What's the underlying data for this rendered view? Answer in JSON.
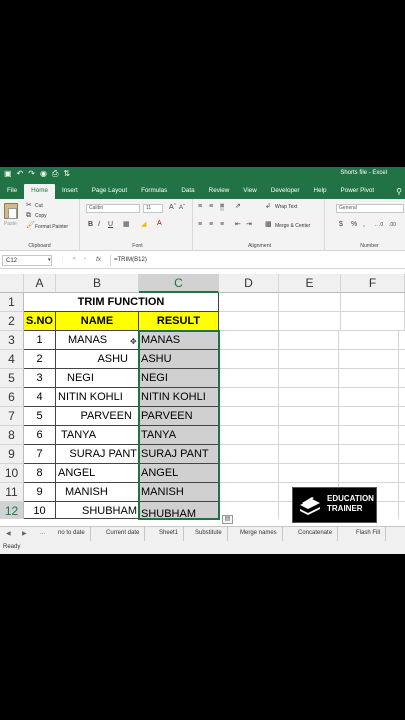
{
  "app": {
    "window_title": "Shorts file  -  Excel",
    "accent": "#217346"
  },
  "ribbon_tabs": [
    "File",
    "Home",
    "Insert",
    "Page Layout",
    "Formulas",
    "Data",
    "Review",
    "View",
    "Developer",
    "Help",
    "Power Pivot"
  ],
  "ribbon": {
    "clipboard": {
      "cut": "Cut",
      "copy": "Copy",
      "format_painter": "Format Painter",
      "paste": "Paste",
      "label": "Clipboard"
    },
    "font": {
      "name": "Calibri",
      "size": "11",
      "label": "Font"
    },
    "alignment": {
      "wrap_text": "Wrap Text",
      "merge_center": "Merge & Center",
      "label": "Alignment"
    },
    "number": {
      "format": "General",
      "label": "Number"
    }
  },
  "formula_bar": {
    "name_box": "C12",
    "fx": "fx",
    "formula": "=TRIM(B12)"
  },
  "columns": [
    "A",
    "B",
    "C",
    "D",
    "E",
    "F"
  ],
  "rows": [
    "1",
    "2",
    "3",
    "4",
    "5",
    "6",
    "7",
    "8",
    "9",
    "10",
    "11",
    "12"
  ],
  "sheet": {
    "title": "TRIM FUNCTION",
    "headers": {
      "sno": "S.NO",
      "name": "NAME",
      "result": "RESULT"
    },
    "data": [
      {
        "sno": "1",
        "name": "MANAS",
        "result": "MANAS"
      },
      {
        "sno": "2",
        "name": "ASHU",
        "result": "ASHU"
      },
      {
        "sno": "3",
        "name": "NEGI",
        "result": "NEGI"
      },
      {
        "sno": "4",
        "name": "NITIN KOHLI",
        "result": "NITIN KOHLI"
      },
      {
        "sno": "5",
        "name": "PARVEEN",
        "result": "PARVEEN"
      },
      {
        "sno": "6",
        "name": "TANYA",
        "result": "TANYA"
      },
      {
        "sno": "7",
        "name": "SURAJ PANT",
        "result": "SURAJ PANT"
      },
      {
        "sno": "8",
        "name": "ANGEL",
        "result": "ANGEL"
      },
      {
        "sno": "9",
        "name": "MANISH",
        "result": "MANISH"
      },
      {
        "sno": "10",
        "name": "SHUBHAM",
        "result": "SHUBHAM"
      }
    ]
  },
  "sheet_tabs": {
    "ellipsis": "...",
    "items": [
      "no to date",
      "Current date",
      "Sheet1",
      "Substitute",
      "Merge names",
      "Concatenate",
      "Flash Fill"
    ]
  },
  "status": {
    "ready": "Ready"
  },
  "logo": {
    "line1": "EDUCATION",
    "line2": "TRAINER"
  }
}
